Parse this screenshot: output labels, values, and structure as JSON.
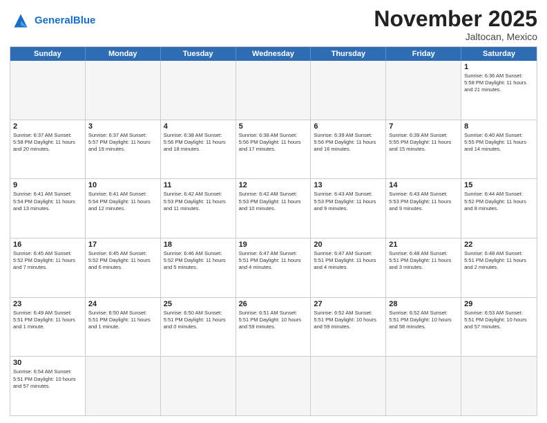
{
  "header": {
    "logo_general": "General",
    "logo_blue": "Blue",
    "title": "November 2025",
    "subtitle": "Jaltocan, Mexico"
  },
  "weekdays": [
    "Sunday",
    "Monday",
    "Tuesday",
    "Wednesday",
    "Thursday",
    "Friday",
    "Saturday"
  ],
  "rows": [
    [
      {
        "day": "",
        "text": ""
      },
      {
        "day": "",
        "text": ""
      },
      {
        "day": "",
        "text": ""
      },
      {
        "day": "",
        "text": ""
      },
      {
        "day": "",
        "text": ""
      },
      {
        "day": "",
        "text": ""
      },
      {
        "day": "1",
        "text": "Sunrise: 6:36 AM\nSunset: 5:58 PM\nDaylight: 11 hours\nand 21 minutes."
      }
    ],
    [
      {
        "day": "2",
        "text": "Sunrise: 6:37 AM\nSunset: 5:58 PM\nDaylight: 11 hours\nand 20 minutes."
      },
      {
        "day": "3",
        "text": "Sunrise: 6:37 AM\nSunset: 5:57 PM\nDaylight: 11 hours\nand 19 minutes."
      },
      {
        "day": "4",
        "text": "Sunrise: 6:38 AM\nSunset: 5:56 PM\nDaylight: 11 hours\nand 18 minutes."
      },
      {
        "day": "5",
        "text": "Sunrise: 6:38 AM\nSunset: 5:56 PM\nDaylight: 11 hours\nand 17 minutes."
      },
      {
        "day": "6",
        "text": "Sunrise: 6:39 AM\nSunset: 5:56 PM\nDaylight: 11 hours\nand 16 minutes."
      },
      {
        "day": "7",
        "text": "Sunrise: 6:39 AM\nSunset: 5:55 PM\nDaylight: 11 hours\nand 15 minutes."
      },
      {
        "day": "8",
        "text": "Sunrise: 6:40 AM\nSunset: 5:55 PM\nDaylight: 11 hours\nand 14 minutes."
      }
    ],
    [
      {
        "day": "9",
        "text": "Sunrise: 6:41 AM\nSunset: 5:54 PM\nDaylight: 11 hours\nand 13 minutes."
      },
      {
        "day": "10",
        "text": "Sunrise: 6:41 AM\nSunset: 5:54 PM\nDaylight: 11 hours\nand 12 minutes."
      },
      {
        "day": "11",
        "text": "Sunrise: 6:42 AM\nSunset: 5:53 PM\nDaylight: 11 hours\nand 11 minutes."
      },
      {
        "day": "12",
        "text": "Sunrise: 6:42 AM\nSunset: 5:53 PM\nDaylight: 11 hours\nand 10 minutes."
      },
      {
        "day": "13",
        "text": "Sunrise: 6:43 AM\nSunset: 5:53 PM\nDaylight: 11 hours\nand 9 minutes."
      },
      {
        "day": "14",
        "text": "Sunrise: 6:43 AM\nSunset: 5:53 PM\nDaylight: 11 hours\nand 9 minutes."
      },
      {
        "day": "15",
        "text": "Sunrise: 6:44 AM\nSunset: 5:52 PM\nDaylight: 11 hours\nand 8 minutes."
      }
    ],
    [
      {
        "day": "16",
        "text": "Sunrise: 6:45 AM\nSunset: 5:52 PM\nDaylight: 11 hours\nand 7 minutes."
      },
      {
        "day": "17",
        "text": "Sunrise: 6:45 AM\nSunset: 5:52 PM\nDaylight: 11 hours\nand 6 minutes."
      },
      {
        "day": "18",
        "text": "Sunrise: 6:46 AM\nSunset: 5:52 PM\nDaylight: 11 hours\nand 5 minutes."
      },
      {
        "day": "19",
        "text": "Sunrise: 6:47 AM\nSunset: 5:51 PM\nDaylight: 11 hours\nand 4 minutes."
      },
      {
        "day": "20",
        "text": "Sunrise: 6:47 AM\nSunset: 5:51 PM\nDaylight: 11 hours\nand 4 minutes."
      },
      {
        "day": "21",
        "text": "Sunrise: 6:48 AM\nSunset: 5:51 PM\nDaylight: 11 hours\nand 3 minutes."
      },
      {
        "day": "22",
        "text": "Sunrise: 6:48 AM\nSunset: 5:51 PM\nDaylight: 11 hours\nand 2 minutes."
      }
    ],
    [
      {
        "day": "23",
        "text": "Sunrise: 6:49 AM\nSunset: 5:51 PM\nDaylight: 11 hours\nand 1 minute."
      },
      {
        "day": "24",
        "text": "Sunrise: 6:50 AM\nSunset: 5:51 PM\nDaylight: 11 hours\nand 1 minute."
      },
      {
        "day": "25",
        "text": "Sunrise: 6:50 AM\nSunset: 5:51 PM\nDaylight: 11 hours\nand 0 minutes."
      },
      {
        "day": "26",
        "text": "Sunrise: 6:51 AM\nSunset: 5:51 PM\nDaylight: 10 hours\nand 59 minutes."
      },
      {
        "day": "27",
        "text": "Sunrise: 6:52 AM\nSunset: 5:51 PM\nDaylight: 10 hours\nand 59 minutes."
      },
      {
        "day": "28",
        "text": "Sunrise: 6:52 AM\nSunset: 5:51 PM\nDaylight: 10 hours\nand 58 minutes."
      },
      {
        "day": "29",
        "text": "Sunrise: 6:53 AM\nSunset: 5:51 PM\nDaylight: 10 hours\nand 57 minutes."
      }
    ],
    [
      {
        "day": "30",
        "text": "Sunrise: 6:54 AM\nSunset: 5:51 PM\nDaylight: 10 hours\nand 57 minutes."
      },
      {
        "day": "",
        "text": ""
      },
      {
        "day": "",
        "text": ""
      },
      {
        "day": "",
        "text": ""
      },
      {
        "day": "",
        "text": ""
      },
      {
        "day": "",
        "text": ""
      },
      {
        "day": "",
        "text": ""
      }
    ]
  ]
}
